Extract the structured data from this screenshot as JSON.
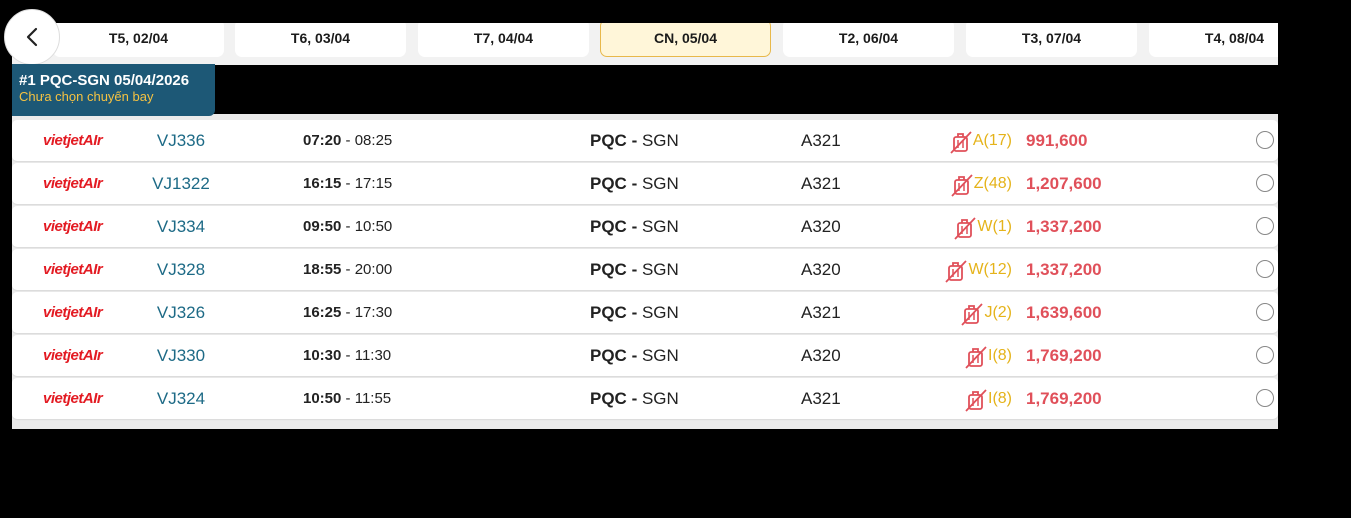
{
  "date_tabs": [
    {
      "label": "T5, 02/04",
      "active": false
    },
    {
      "label": "T6, 03/04",
      "active": false
    },
    {
      "label": "T7, 04/04",
      "active": false
    },
    {
      "label": "CN, 05/04",
      "active": true
    },
    {
      "label": "T2, 06/04",
      "active": false
    },
    {
      "label": "T3, 07/04",
      "active": false
    },
    {
      "label": "T4, 08/04",
      "active": false
    }
  ],
  "leg": {
    "title": "#1 PQC-SGN 05/04/2026",
    "subtitle": "Chưa chọn chuyến bay"
  },
  "airline": {
    "brand_main": "vietjet",
    "brand_air": "AIr",
    "color": "#e31b23"
  },
  "flights": [
    {
      "code": "VJ336",
      "depart": "07:20",
      "arrive": "08:25",
      "from": "PQC",
      "to": "SGN",
      "aircraft": "A321",
      "fare_class": "A(17)",
      "price": "991,600"
    },
    {
      "code": "VJ1322",
      "depart": "16:15",
      "arrive": "17:15",
      "from": "PQC",
      "to": "SGN",
      "aircraft": "A321",
      "fare_class": "Z(48)",
      "price": "1,207,600"
    },
    {
      "code": "VJ334",
      "depart": "09:50",
      "arrive": "10:50",
      "from": "PQC",
      "to": "SGN",
      "aircraft": "A320",
      "fare_class": "W(1)",
      "price": "1,337,200"
    },
    {
      "code": "VJ328",
      "depart": "18:55",
      "arrive": "20:00",
      "from": "PQC",
      "to": "SGN",
      "aircraft": "A320",
      "fare_class": "W(12)",
      "price": "1,337,200"
    },
    {
      "code": "VJ326",
      "depart": "16:25",
      "arrive": "17:30",
      "from": "PQC",
      "to": "SGN",
      "aircraft": "A321",
      "fare_class": "J(2)",
      "price": "1,639,600"
    },
    {
      "code": "VJ330",
      "depart": "10:30",
      "arrive": "11:30",
      "from": "PQC",
      "to": "SGN",
      "aircraft": "A320",
      "fare_class": "I(8)",
      "price": "1,769,200"
    },
    {
      "code": "VJ324",
      "depart": "10:50",
      "arrive": "11:55",
      "from": "PQC",
      "to": "SGN",
      "aircraft": "A321",
      "fare_class": "I(8)",
      "price": "1,769,200"
    }
  ],
  "icons": {
    "back": "chevron-left-icon",
    "baggage": "no-baggage-icon",
    "select": "radio-icon"
  },
  "colors": {
    "leg_badge": "#1d5876",
    "price": "#e0505a",
    "fare_class": "#e5b31a",
    "flight_code": "#1d6a86",
    "active_tab": "#fff6d9"
  }
}
